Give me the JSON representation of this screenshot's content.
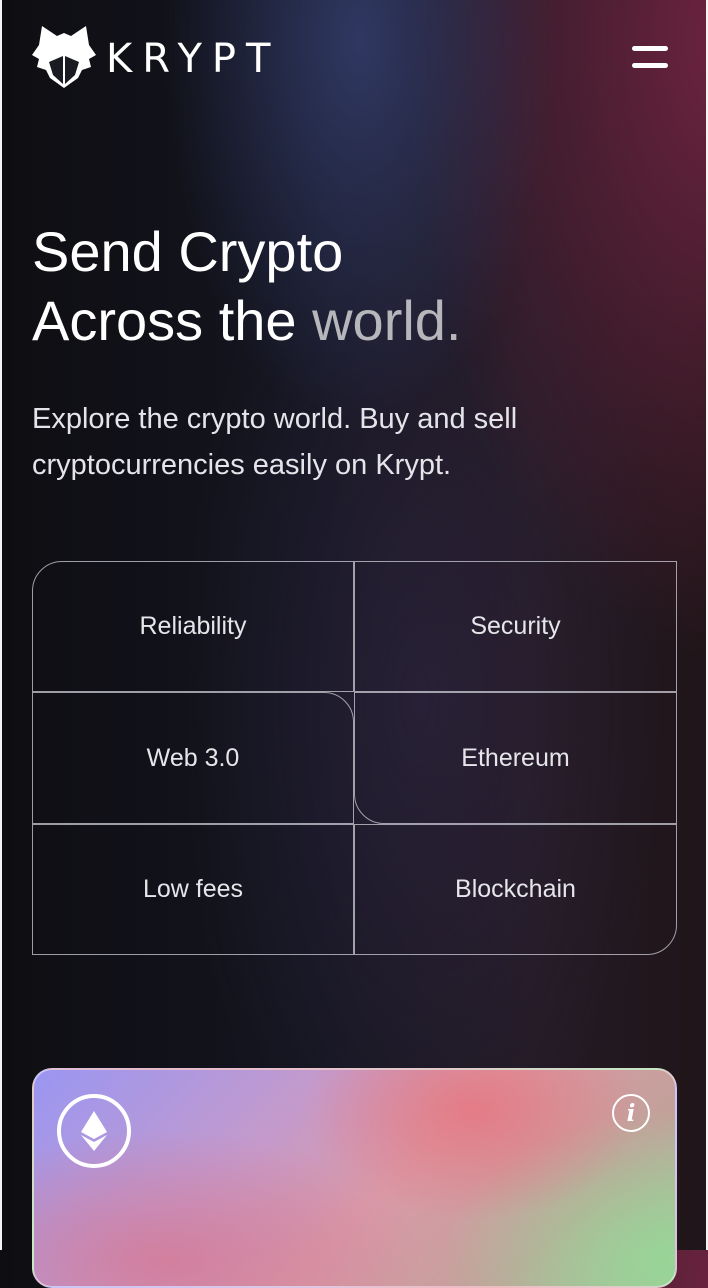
{
  "header": {
    "brand": "KRYPT",
    "logo_icon": "wolf-head-icon",
    "menu_icon": "hamburger-menu-icon"
  },
  "hero": {
    "title_line1": "Send Crypto",
    "title_line2_prefix": "Across the ",
    "title_line2_accent": "world.",
    "subtitle": "Explore the crypto world. Buy and sell cryptocurrencies easily on Krypt."
  },
  "features": [
    {
      "label": "Reliability"
    },
    {
      "label": "Security"
    },
    {
      "label": "Web 3.0"
    },
    {
      "label": "Ethereum"
    },
    {
      "label": "Low fees"
    },
    {
      "label": "Blockchain"
    }
  ],
  "card": {
    "badge_icon": "ethereum-icon",
    "info_icon": "info-icon",
    "info_glyph": "i"
  },
  "colors": {
    "accent_text": "#b6b6bb",
    "border": "#cdcdd7"
  }
}
